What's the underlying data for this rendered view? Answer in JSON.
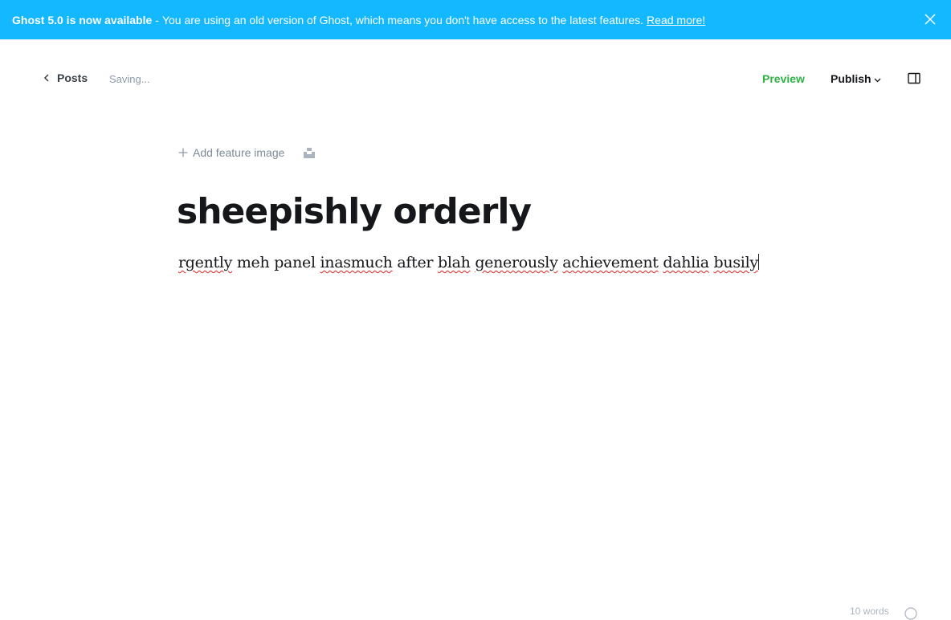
{
  "banner": {
    "headline": "Ghost 5.0 is now available",
    "separator": "-",
    "message": "You are using an old version of Ghost, which means you don't have access to the latest features.",
    "link_label": "Read more!",
    "close_icon": "close-icon",
    "background_color": "#14b8ff"
  },
  "header": {
    "back_label": "Posts",
    "back_icon": "chevron-left-icon",
    "status": "Saving...",
    "preview_label": "Preview",
    "publish_label": "Publish",
    "publish_icon": "chevron-down-icon",
    "settings_icon": "sidebar-toggle-icon",
    "accent_color": "#2fb344"
  },
  "editor": {
    "add_feature_label": "Add feature image",
    "add_feature_icon": "plus-icon",
    "unsplash_icon": "unsplash-icon",
    "title": "sheepishly orderly",
    "body_words": [
      "rgently",
      "meh",
      "panel",
      "inasmuch",
      "after",
      "blah",
      "generously",
      "achievement",
      "dahlia",
      "busily"
    ],
    "misspelled_words": [
      "rgently",
      "inasmuch",
      "blah",
      "generously",
      "achievement",
      "dahlia",
      "busily"
    ]
  },
  "footer": {
    "word_count": "10 words",
    "help_icon": "help-icon"
  }
}
